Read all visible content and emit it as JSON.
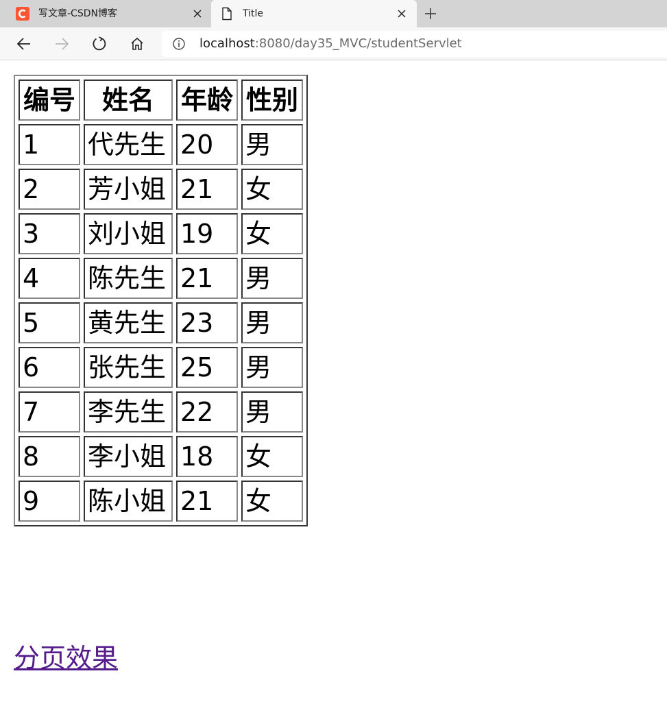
{
  "browser": {
    "tabs": [
      {
        "title": "写文章-CSDN博客",
        "icon": "csdn-logo-icon",
        "active": false
      },
      {
        "title": "Title",
        "icon": "document-icon",
        "active": true
      }
    ],
    "url_host": "localhost",
    "url_rest": ":8080/day35_MVC/studentServlet"
  },
  "table": {
    "headers": [
      "编号",
      "姓名",
      "年龄",
      "性别"
    ],
    "rows": [
      [
        "1",
        "代先生",
        "20",
        "男"
      ],
      [
        "2",
        "芳小姐",
        "21",
        "女"
      ],
      [
        "3",
        "刘小姐",
        "19",
        "女"
      ],
      [
        "4",
        "陈先生",
        "21",
        "男"
      ],
      [
        "5",
        "黄先生",
        "23",
        "男"
      ],
      [
        "6",
        "张先生",
        "25",
        "男"
      ],
      [
        "7",
        "李先生",
        "22",
        "男"
      ],
      [
        "8",
        "李小姐",
        "18",
        "女"
      ],
      [
        "9",
        "陈小姐",
        "21",
        "女"
      ]
    ]
  },
  "pagination_link": "分页效果",
  "colors": {
    "csdn_brand": "#fc5531",
    "visited_link": "#551a8b"
  }
}
